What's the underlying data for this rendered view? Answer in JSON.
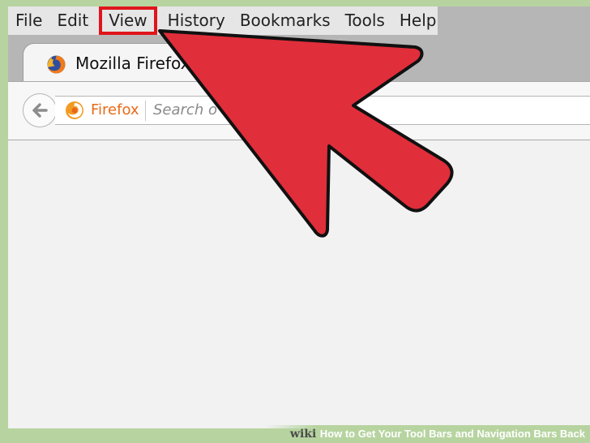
{
  "menubar": {
    "items": [
      "File",
      "Edit",
      "View",
      "History",
      "Bookmarks",
      "Tools",
      "Help"
    ],
    "highlighted": "View"
  },
  "tab": {
    "title": "Mozilla Firefox",
    "icon": "firefox-icon"
  },
  "navbar": {
    "back_icon": "back-arrow-icon",
    "identity_icon": "firefox-icon",
    "identity_label": "Firefox",
    "search_placeholder": "Search o"
  },
  "annotation": {
    "arrow_color": "#e02e3a",
    "highlight_color": "#e0151c"
  },
  "caption": {
    "brand": "wiki",
    "title": "How to Get Your Tool Bars and Navigation Bars Back"
  }
}
